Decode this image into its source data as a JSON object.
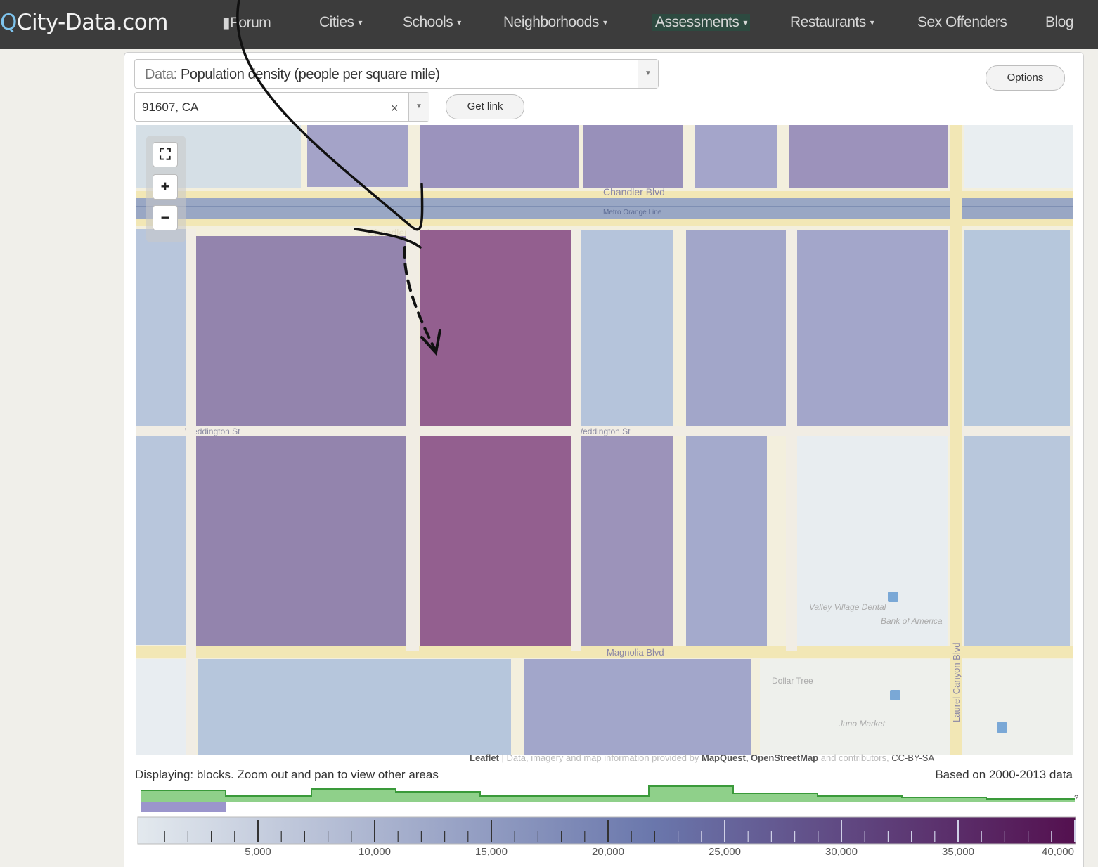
{
  "navbar": {
    "logo": "City-Data.com",
    "items": [
      {
        "label": "Forum"
      },
      {
        "label": "Cities"
      },
      {
        "label": "Schools"
      },
      {
        "label": "Neighborhoods"
      },
      {
        "label": "Assessments"
      },
      {
        "label": "Restaurants"
      },
      {
        "label": "Sex Offenders"
      },
      {
        "label": "Blog"
      }
    ]
  },
  "controls": {
    "data_label": "Data:",
    "data_value": "Population density (people per square mile)",
    "zip_value": "91607, CA",
    "clear": "×",
    "get_link": "Get link",
    "options": "Options"
  },
  "map": {
    "streets": [
      "Chandler Blvd",
      "Metro Orange Line",
      "Chandler Blvd",
      "Weddington St",
      "Weddington St",
      "Magnolia Blvd",
      "Laurel Canyon Blvd"
    ],
    "places": [
      "Valley Village Dental",
      "Bank of America",
      "Dollar Tree",
      "Juno Market"
    ],
    "zoom_controls": {
      "fit": "⛶",
      "zoom_in": "+",
      "zoom_out": "−"
    },
    "colors": {
      "lowest": "#e6edf2",
      "low": "#b6c8db",
      "mid": "#a2a6ca",
      "high": "#9387af",
      "highest": "#935f8f"
    }
  },
  "attribution": {
    "leaflet": "Leaflet",
    "text": " | Data, imagery and map information provided by ",
    "sources": "MapQuest, OpenStreetMap",
    "and": " and contributors, ",
    "license": "CC-BY-SA"
  },
  "status": {
    "displaying": "Displaying: blocks. Zoom out and pan to view other areas",
    "based_on": "Based on 2000-2013 data",
    "histogram_marker": "?"
  },
  "legend": {
    "ticks": [
      "5,000",
      "10,000",
      "15,000",
      "20,000",
      "25,000",
      "30,000",
      "35,000",
      "40,000"
    ],
    "min": 0,
    "max": 40000,
    "color_start": "#e3e9ee",
    "color_mid": "#6a77ac",
    "color_end": "#54104f"
  }
}
